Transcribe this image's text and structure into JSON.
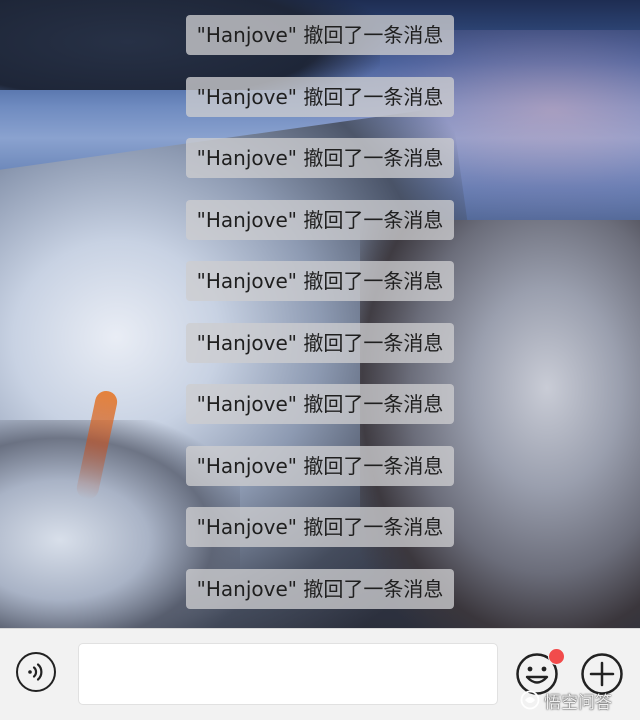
{
  "chat": {
    "notices": [
      "\"Hanjove\" 撤回了一条消息",
      "\"Hanjove\" 撤回了一条消息",
      "\"Hanjove\" 撤回了一条消息",
      "\"Hanjove\" 撤回了一条消息",
      "\"Hanjove\" 撤回了一条消息",
      "\"Hanjove\" 撤回了一条消息",
      "\"Hanjove\" 撤回了一条消息",
      "\"Hanjove\" 撤回了一条消息",
      "\"Hanjove\" 撤回了一条消息",
      "\"Hanjove\" 撤回了一条消息"
    ]
  },
  "input_bar": {
    "voice_icon": "voice-icon",
    "text_value": "",
    "emoji_icon": "emoji-icon",
    "emoji_badge_color": "#f24b4b",
    "plus_icon": "plus-icon"
  },
  "watermark": {
    "text": "悟空问答"
  }
}
